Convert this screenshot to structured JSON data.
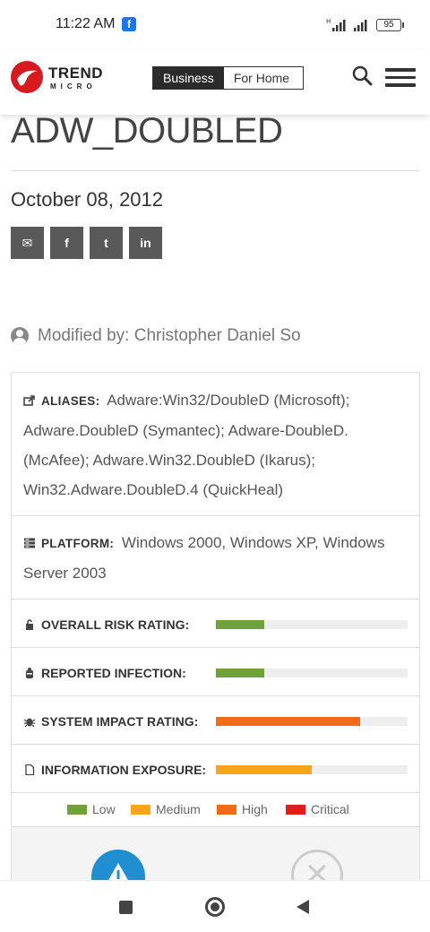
{
  "status_bar": {
    "time": "11:22 AM",
    "app_badge": "f",
    "network_label": "H",
    "battery": "95"
  },
  "header": {
    "logo_line1": "TREND",
    "logo_line2": "MICRO",
    "tabs": [
      {
        "label": "Business",
        "active": true
      },
      {
        "label": "For Home",
        "active": false
      }
    ],
    "brand_color": "#d71920"
  },
  "article": {
    "title": "ADW_DOUBLED",
    "date": "October 08, 2012",
    "share_buttons": [
      {
        "icon": "email-icon",
        "glyph": "✉"
      },
      {
        "icon": "facebook-icon",
        "glyph": "f"
      },
      {
        "icon": "twitter-icon",
        "glyph": "t"
      },
      {
        "icon": "linkedin-icon",
        "glyph": "in"
      }
    ],
    "modified_by": "Modified by: Christopher Daniel So"
  },
  "details": {
    "aliases_label": "ALIASES:",
    "aliases_value": "Adware:Win32/DoubleD (Microsoft); Adware.DoubleD (Symantec); Adware-DoubleD. (McAfee); Adware.Win32.DoubleD (Ikarus); Win32.Adware.DoubleD.4 (QuickHeal)",
    "platform_label": "PLATFORM:",
    "platform_value": "Windows 2000, Windows XP, Windows Server 2003"
  },
  "ratings": [
    {
      "label": "OVERALL RISK RATING:",
      "icon": "lock-icon",
      "level": "Low",
      "fraction": 0.25,
      "color": "#6fa23a"
    },
    {
      "label": "REPORTED INFECTION:",
      "icon": "bug-report-icon",
      "level": "Low",
      "fraction": 0.25,
      "color": "#6fa23a"
    },
    {
      "label": "SYSTEM IMPACT RATING:",
      "icon": "bug-icon",
      "level": "High",
      "fraction": 0.75,
      "color": "#f26b1d"
    },
    {
      "label": "INFORMATION EXPOSURE:",
      "icon": "document-icon",
      "level": "Medium",
      "fraction": 0.5,
      "color": "#f9a51a"
    }
  ],
  "legend": [
    {
      "label": "Low",
      "color": "#6fa23a"
    },
    {
      "label": "Medium",
      "color": "#f9a51a"
    },
    {
      "label": "High",
      "color": "#f26b1d"
    },
    {
      "label": "Critical",
      "color": "#e01e1e"
    }
  ]
}
